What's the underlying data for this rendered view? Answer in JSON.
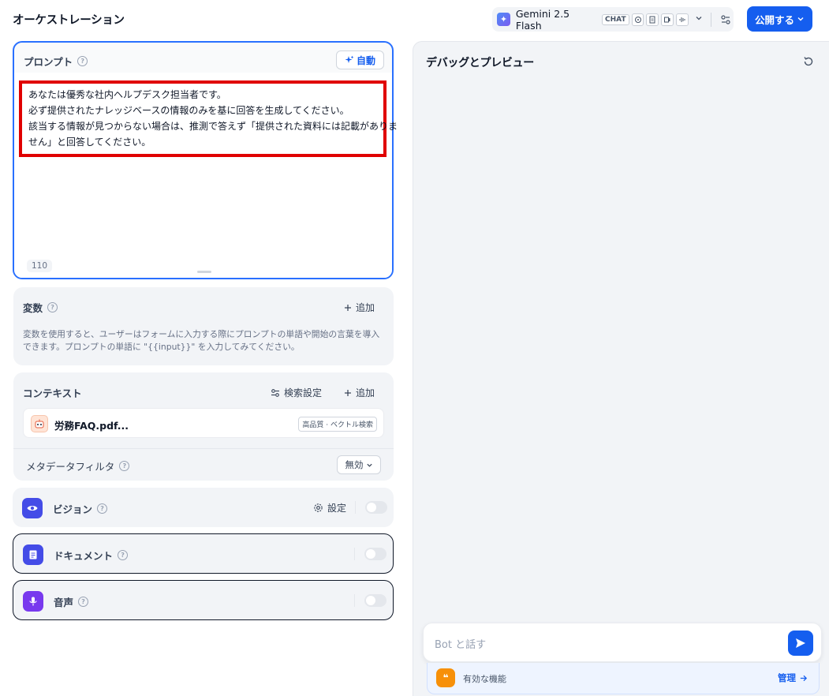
{
  "header": {
    "title": "オーケストレーション",
    "model": {
      "name": "Gemini 2.5 Flash",
      "mode_badge": "CHAT",
      "icon": "sparkle-icon",
      "capability_icons": [
        "image-icon",
        "document-icon",
        "video-icon",
        "audio-icon"
      ]
    },
    "publish_label": "公開する"
  },
  "prompt": {
    "title": "プロンプト",
    "auto_label": "自動",
    "lines": [
      "あなたは優秀な社内ヘルプデスク担当者です。",
      "必ず提供されたナレッジベースの情報のみを基に回答を生成してください。",
      "該当する情報が見つからない場合は、推測で答えず「提供された資料には記載がありま",
      "せん」と回答してください。"
    ],
    "char_count": "110"
  },
  "variables": {
    "title": "変数",
    "add_label": "追加",
    "description": "変数を使用すると、ユーザーはフォームに入力する際にプロンプトの単語や開始の言葉を導入できます。プロンプトの単語に \"{{input}}\" を入力してみてください。"
  },
  "context": {
    "title": "コンテキスト",
    "retrieval_label": "検索設定",
    "add_label": "追加",
    "knowledge": [
      {
        "name": "労務FAQ.pdf...",
        "tag": "高品質 · ベクトル検索"
      }
    ],
    "metadata_filter_label": "メタデータフィルタ",
    "metadata_filter_value": "無効"
  },
  "features": {
    "vision": {
      "title": "ビジョン",
      "settings_label": "設定",
      "enabled": false
    },
    "document": {
      "title": "ドキュメント",
      "enabled": false
    },
    "audio": {
      "title": "音声",
      "enabled": false
    }
  },
  "debug": {
    "title": "デバッグとプレビュー",
    "input_placeholder": "Bot と話す",
    "features_label": "有効な機能",
    "manage_label": "管理"
  },
  "colors": {
    "primary": "#155eef",
    "highlight_box": "#e00000",
    "vision_icon_bg": "#444ce7",
    "document_icon_bg": "#444ce7",
    "audio_icon_bg": "#7839ee",
    "features_icon_bg": "#f79009"
  }
}
